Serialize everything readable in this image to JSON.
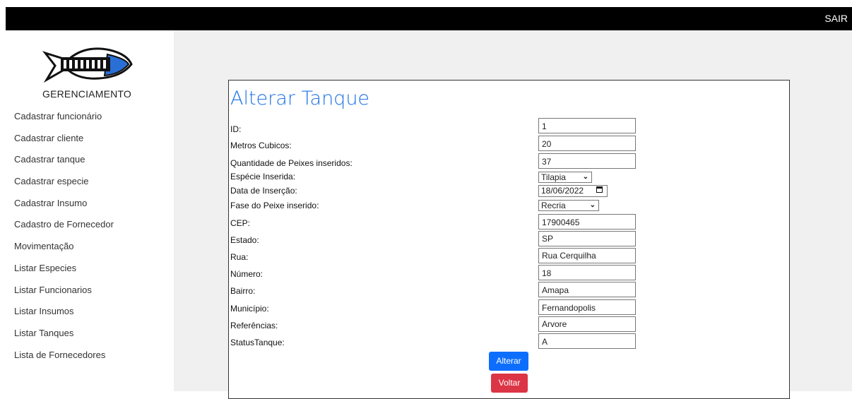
{
  "header": {
    "logout_label": "SAIR"
  },
  "sidebar": {
    "brand": "GERENCIAMENTO",
    "items": [
      "Cadastrar funcionário",
      "Cadastrar cliente",
      " Cadastrar tanque",
      "Cadastrar especie",
      "Cadastrar Insumo",
      "Cadastro de Fornecedor",
      "Movimentação",
      "Listar Especies",
      "Listar Funcionarios",
      "Listar Insumos",
      "Listar Tanques",
      "Lista de Fornecedores"
    ]
  },
  "form": {
    "title": "Alterar Tanque",
    "id_label": "ID:",
    "id_value": "1",
    "metros_label": "Metros Cubicos:",
    "metros_value": "20",
    "qtd_label": "Quantidade de Peixes inseridos:",
    "qtd_value": "37",
    "especie_label": "Espécie Inserida:",
    "especie_value": "Tilapia",
    "data_label": "Data de Inserção:",
    "data_value": "18/06/2022",
    "fase_label": "Fase do Peixe inserido:",
    "fase_value": "Recria",
    "cep_label": "CEP:",
    "cep_value": "17900465",
    "estado_label": "Estado:",
    "estado_value": "SP",
    "rua_label": "Rua:",
    "rua_value": "Rua Cerquilha",
    "numero_label": "Número:",
    "numero_value": "18",
    "bairro_label": "Bairro:",
    "bairro_value": "Amapa",
    "municipio_label": "Município:",
    "municipio_value": "Fernandopolis",
    "referencias_label": "Referências:",
    "referencias_value": "Arvore",
    "status_label": "StatusTanque:",
    "status_value": "A",
    "alterar_label": "Alterar",
    "voltar_label": "Voltar"
  },
  "colors": {
    "title": "#1e73e6",
    "alterar": "#0d6efd",
    "voltar": "#dc3545",
    "topbar": "#000000"
  },
  "icons": {
    "logo": "fish-logo",
    "calendar": "calendar-icon",
    "dropdown": "chevron-down-icon"
  }
}
